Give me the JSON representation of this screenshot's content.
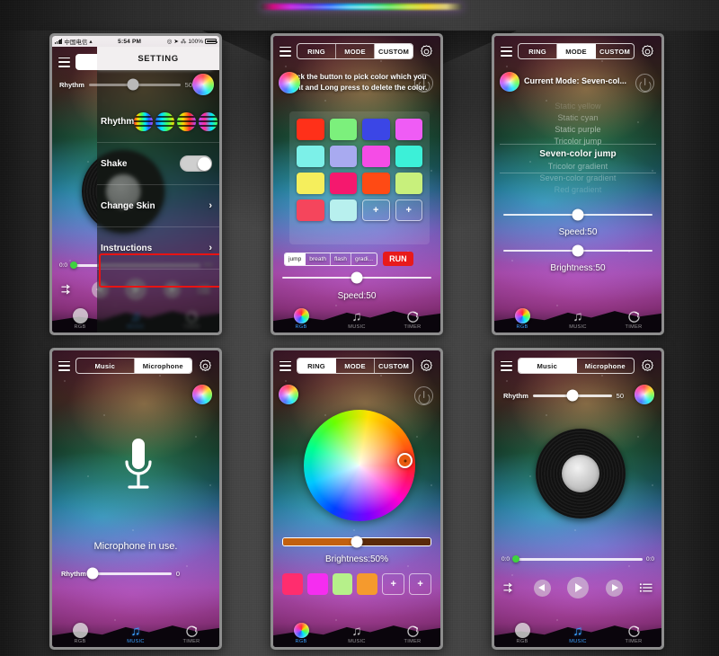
{
  "statusbar": {
    "carrier": "中国电信",
    "time": "5:54 PM",
    "battery": "100%"
  },
  "phone1": {
    "name": "settings-screen",
    "sheet_title": "SETTING",
    "rows": [
      {
        "label": "Rhythm",
        "type": "icons",
        "chevron": "›"
      },
      {
        "label": "Shake",
        "type": "toggle",
        "chevron": ""
      },
      {
        "label": "Change Skin",
        "type": "chevron",
        "chevron": "›"
      },
      {
        "label": "Instructions",
        "type": "chevron",
        "chevron": "›",
        "highlighted": true
      }
    ],
    "rhythm_slider": {
      "label": "Rhythm",
      "value": "50"
    },
    "time_start": "0:0",
    "time_end": "0:0",
    "nav": [
      {
        "label": "RGB",
        "icon": "rgb-circle-icon",
        "active": false
      },
      {
        "label": "MUSIC",
        "icon": "music-note-icon",
        "active": true
      },
      {
        "label": "TIMER",
        "icon": "timer-icon",
        "active": false
      }
    ]
  },
  "phone2": {
    "name": "custom-color-screen",
    "tabs": [
      {
        "label": "RING",
        "active": false
      },
      {
        "label": "MODE",
        "active": false
      },
      {
        "label": "CUSTOM",
        "active": true
      }
    ],
    "instruction": "Click the button to pick color which you want and Long press to delete the color.",
    "swatches": [
      "#ff3019",
      "#7cf07c",
      "#3b46e6",
      "#ef5cf5",
      "#7cf0e8",
      "#a8aaf0",
      "#f54ce6",
      "#3cf0d8",
      "#f5ee5c",
      "#f5186e",
      "#ff4a14",
      "#c8f07c",
      "#f5455c",
      "#b8f0ee",
      "+",
      "+"
    ],
    "effects": [
      {
        "label": "jump",
        "active": true
      },
      {
        "label": "breath",
        "active": false
      },
      {
        "label": "flash",
        "active": false
      },
      {
        "label": "gradi...",
        "active": false
      }
    ],
    "run_label": "RUN",
    "speed_caption": "Speed:50",
    "nav": [
      {
        "label": "RGB",
        "icon": "rgb-circle-icon",
        "active": true
      },
      {
        "label": "MUSIC",
        "icon": "music-note-icon",
        "active": false
      },
      {
        "label": "TIMER",
        "icon": "timer-icon",
        "active": false
      }
    ]
  },
  "phone3": {
    "name": "mode-list-screen",
    "tabs": [
      {
        "label": "RING",
        "active": false
      },
      {
        "label": "MODE",
        "active": true
      },
      {
        "label": "CUSTOM",
        "active": false
      }
    ],
    "current_mode": "Current Mode: Seven-col...",
    "modes": [
      {
        "label": "Static yellow",
        "fade": "f1"
      },
      {
        "label": "Static cyan",
        "fade": "f2"
      },
      {
        "label": "Static purple",
        "fade": "f3"
      },
      {
        "label": "Tricolor jump",
        "fade": "f3"
      },
      {
        "label": "Seven-color jump",
        "fade": "sel"
      },
      {
        "label": "Tricolor gradient",
        "fade": "f4"
      },
      {
        "label": "Seven-color gradient",
        "fade": "f5"
      },
      {
        "label": "Red gradient",
        "fade": "f6"
      }
    ],
    "speed_caption": "Speed:50",
    "brightness_caption": "Brightness:50",
    "nav": [
      {
        "label": "RGB",
        "icon": "rgb-circle-icon",
        "active": true
      },
      {
        "label": "MUSIC",
        "icon": "music-note-icon",
        "active": false
      },
      {
        "label": "TIMER",
        "icon": "timer-icon",
        "active": false
      }
    ]
  },
  "phone4": {
    "name": "microphone-screen",
    "tabs": [
      {
        "label": "Music",
        "active": false
      },
      {
        "label": "Microphone",
        "active": true
      }
    ],
    "status_text": "Microphone in use.",
    "rhythm_slider": {
      "label": "Rhythm",
      "value": "0"
    },
    "nav": [
      {
        "label": "RGB",
        "icon": "rgb-circle-icon",
        "active": false
      },
      {
        "label": "MUSIC",
        "icon": "music-note-icon",
        "active": true
      },
      {
        "label": "TIMER",
        "icon": "timer-icon",
        "active": false
      }
    ]
  },
  "phone5": {
    "name": "ring-color-wheel-screen",
    "tabs": [
      {
        "label": "RING",
        "active": true
      },
      {
        "label": "MODE",
        "active": false
      },
      {
        "label": "CUSTOM",
        "active": false
      }
    ],
    "brightness_caption": "Brightness:50%",
    "swatches": [
      "#ff2d6e",
      "#f52df0",
      "#b6f08a",
      "#f59a2d",
      "+",
      "+"
    ],
    "nav": [
      {
        "label": "RGB",
        "icon": "rgb-circle-icon",
        "active": true
      },
      {
        "label": "MUSIC",
        "icon": "music-note-icon",
        "active": false
      },
      {
        "label": "TIMER",
        "icon": "timer-icon",
        "active": false
      }
    ]
  },
  "phone6": {
    "name": "music-player-screen",
    "tabs": [
      {
        "label": "Music",
        "active": true
      },
      {
        "label": "Microphone",
        "active": false
      }
    ],
    "rhythm_slider": {
      "label": "Rhythm",
      "value": "50"
    },
    "time_start": "0:0",
    "time_end": "0:0",
    "controls": [
      "shuffle-icon",
      "previous-icon",
      "play-icon",
      "next-icon",
      "playlist-icon"
    ],
    "nav": [
      {
        "label": "RGB",
        "icon": "rgb-circle-icon",
        "active": false
      },
      {
        "label": "MUSIC",
        "icon": "music-note-icon",
        "active": true
      },
      {
        "label": "TIMER",
        "icon": "timer-icon",
        "active": false
      }
    ]
  },
  "colors": {
    "accent_red": "#e81a1a",
    "highlight_box": "#e81313",
    "nav_active": "#3aa0ff"
  }
}
